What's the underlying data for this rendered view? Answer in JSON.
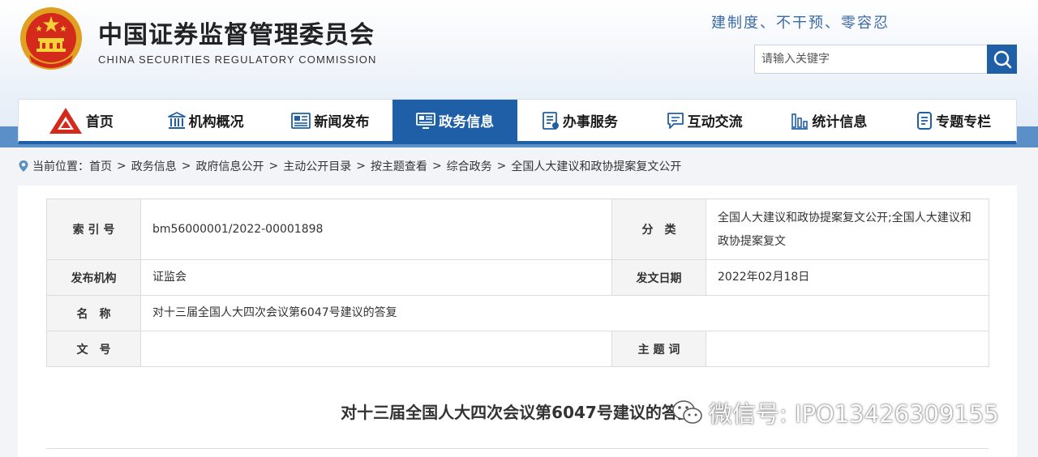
{
  "header": {
    "title_cn": "中国证券监督管理委员会",
    "title_en": "CHINA SECURITIES REGULATORY COMMISSION",
    "slogan": "建制度、不干预、零容忍",
    "search": {
      "placeholder": "请输入关键字",
      "icon": "search-icon"
    }
  },
  "nav": {
    "items": [
      {
        "label": "首页",
        "icon": "csrc-logo-icon",
        "active": false
      },
      {
        "label": "机构概况",
        "icon": "building-icon",
        "active": false
      },
      {
        "label": "新闻发布",
        "icon": "newspaper-icon",
        "active": false
      },
      {
        "label": "政务信息",
        "icon": "monitor-icon",
        "active": true
      },
      {
        "label": "办事服务",
        "icon": "document-list-icon",
        "active": false
      },
      {
        "label": "互动交流",
        "icon": "chat-icon",
        "active": false
      },
      {
        "label": "统计信息",
        "icon": "bar-chart-icon",
        "active": false
      },
      {
        "label": "专题专栏",
        "icon": "notebook-icon",
        "active": false
      }
    ],
    "accent_color": "#1f5fa8"
  },
  "breadcrumb": {
    "prefix": "当前位置：",
    "separator": ">",
    "items": [
      "首页",
      "政务信息",
      "政府信息公开",
      "主动公开目录",
      "按主题查看",
      "综合政务",
      "全国人大建议和政协提案复文公开"
    ]
  },
  "meta": {
    "index_label": "索 引 号",
    "index_value": "bm56000001/2022-00001898",
    "category_label": "分　类",
    "category_value": "全国人大建议和政协提案复文公开;全国人大建议和政协提案复文",
    "org_label": "发布机构",
    "org_value": "证监会",
    "date_label": "发文日期",
    "date_value": "2022年02月18日",
    "name_label": "名　称",
    "name_value": "对十三届全国人大四次会议第6047号建议的答复",
    "docno_label": "文　号",
    "docno_value": "",
    "keywords_label": "主 题 词",
    "keywords_value": ""
  },
  "document": {
    "title": "对十三届全国人大四次会议第6047号建议的答复"
  },
  "watermark": {
    "text": "微信号: IPO13426309155",
    "icon": "wechat-icon"
  }
}
